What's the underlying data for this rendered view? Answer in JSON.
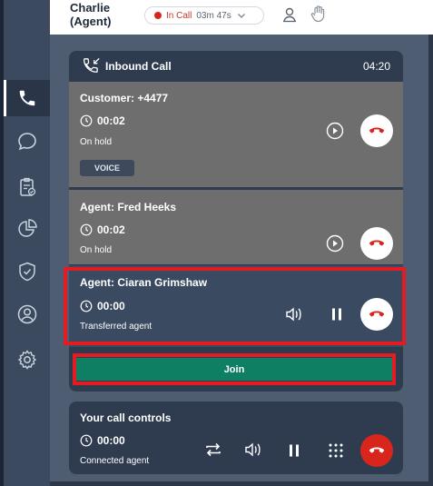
{
  "header": {
    "agent_name_line1": "Charlie",
    "agent_name_line2": "(Agent)",
    "call_status": "In Call",
    "call_timer": "03m 47s"
  },
  "sidebar": {
    "items": [
      {
        "icon": "phone-icon",
        "active": true
      },
      {
        "icon": "chat-icon",
        "active": false
      },
      {
        "icon": "clipboard-icon",
        "active": false
      },
      {
        "icon": "pie-chart-icon",
        "active": false
      },
      {
        "icon": "shield-icon",
        "active": false
      },
      {
        "icon": "user-circle-icon",
        "active": false
      },
      {
        "icon": "gear-icon",
        "active": false
      }
    ]
  },
  "inbound_call": {
    "title": "Inbound Call",
    "elapsed": "04:20",
    "parties": [
      {
        "name": "Customer: +4477",
        "timer": "00:02",
        "status": "On hold",
        "tag": "VOICE"
      },
      {
        "name": "Agent: Fred Heeks",
        "timer": "00:02",
        "status": "On hold"
      },
      {
        "name": "Agent: Ciaran Grimshaw",
        "timer": "00:00",
        "status": "Transferred agent"
      }
    ],
    "join_label": "Join"
  },
  "call_controls": {
    "title": "Your call controls",
    "timer": "00:00",
    "status": "Connected agent"
  },
  "colors": {
    "accent_red": "#e31b23",
    "join_green": "#0e7f62",
    "hangup_red": "#d9261c"
  }
}
